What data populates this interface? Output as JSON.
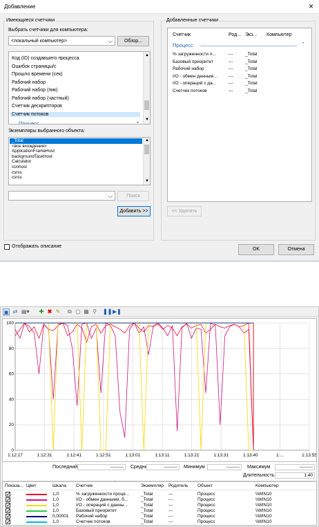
{
  "dialog": {
    "title": "Добавление",
    "close": "×",
    "left_group": "Имеющиеся счетчики",
    "choose_label": "Выбрать счетчики для компьютера:",
    "computer_value": "<локальный компьютер>",
    "browse": "Обзор...",
    "counters": [
      "Код (ID) создавшего процесса",
      "Ошибок страницы/с",
      "Прошло времени (сек)",
      "Рабочий набор",
      "Рабочий набор (пик)",
      "Рабочий набор (частный)",
      "Счетчик дескрипторов",
      "Счетчик потоков"
    ],
    "counter_group": "Процесс",
    "instances_label": "Экземпляры выбранного объекта:",
    "instances": [
      "_Total",
      "<все вхождения>",
      "ApplicationFrameHost",
      "backgroundTaskHost",
      "Calculator",
      "conhost",
      "csrss",
      "csrss"
    ],
    "search": "Поиск",
    "add": "Добавить >>",
    "remove": "<< Удалить",
    "show_desc": "Отображать описание",
    "ok": "OK",
    "cancel": "Отмена",
    "right_group": "Добавленные счетчики",
    "added_cols": [
      "Счетчик",
      "Род...",
      "Экз...",
      "Компьютер"
    ],
    "added_object": "Процесс",
    "added_rows": [
      {
        "counter": "% загруженности п...",
        "parent": "---",
        "inst": "_Total"
      },
      {
        "counter": "Базовый приоритет",
        "parent": "---",
        "inst": "_Total"
      },
      {
        "counter": "Рабочий набор",
        "parent": "---",
        "inst": "_Total"
      },
      {
        "counter": "I/O - обмен данным...",
        "parent": "---",
        "inst": "_Total"
      },
      {
        "counter": "I/O - операций с да...",
        "parent": "---",
        "inst": "_Total"
      },
      {
        "counter": "Счетчик потоков",
        "parent": "---",
        "inst": "_Total"
      }
    ]
  },
  "perfmon": {
    "toolbar_icons": [
      "view-graph-icon",
      "properties-icon",
      "change-graph-icon",
      "add-counter-icon",
      "delete-counter-icon",
      "highlight-icon",
      "copy-icon",
      "paste-icon",
      "properties-sheet-icon",
      "zoom-icon",
      "pause-icon",
      "next-icon"
    ],
    "stats": {
      "last_label": "Последний",
      "last_value": "---------",
      "avg_label": "Средний",
      "avg_value": "---------",
      "min_label": "Минимум",
      "min_value": "---------",
      "max_label": "Максимум",
      "max_value": "---------",
      "dur_label": "Длительность",
      "dur_value": "1:40"
    },
    "table_cols": [
      "Показа...",
      "Цвет",
      "Шкала",
      "Счетчик",
      "Экземпляр",
      "Родитель",
      "Объект",
      "Компьютер"
    ],
    "rows": [
      {
        "color": "#e81123",
        "scale": "1,0",
        "counter": "% загруженности проце...",
        "inst": "_Total",
        "parent": "---",
        "object": "Процесс",
        "computer": "\\\\WIN10"
      },
      {
        "color": "#c71585",
        "scale": "1,0",
        "counter": "I/O - обмен данными, б...",
        "inst": "_Total",
        "parent": "---",
        "object": "Процесс",
        "computer": "\\\\WIN10"
      },
      {
        "color": "#f5d800",
        "scale": "1,0",
        "counter": "I/O - операций с данны...",
        "inst": "_Total",
        "parent": "---",
        "object": "Процесс",
        "computer": "\\\\WIN10"
      },
      {
        "color": "#2ecc40",
        "scale": "1,0",
        "counter": "Базовый приоритет",
        "inst": "_Total",
        "parent": "---",
        "object": "Процесс",
        "computer": "\\\\WIN10"
      },
      {
        "color": "#000080",
        "scale": "0,00001",
        "counter": "Рабочий набор",
        "inst": "_Total",
        "parent": "---",
        "object": "Процесс",
        "computer": "\\\\WIN10"
      },
      {
        "color": "#00b7eb",
        "scale": "1,0",
        "counter": "Счетчик потоков",
        "inst": "_Total",
        "parent": "---",
        "object": "Процесс",
        "computer": "\\\\WIN10"
      }
    ]
  },
  "chart_data": {
    "type": "line",
    "ylim": [
      0,
      100
    ],
    "yticks": [
      0,
      20,
      40,
      60,
      80,
      100
    ],
    "xticks": [
      "1:12:17",
      "1:12:31",
      "1:12:41",
      "1:12:51",
      "1:13:01",
      "1:13:11",
      "1:13:21",
      "1:13:31",
      "1:13:40",
      "1:...",
      "1:13:55"
    ],
    "series": [
      {
        "color": "#c71585",
        "values": [
          95,
          88,
          100,
          97,
          92,
          60,
          99,
          95,
          40,
          99,
          100,
          98,
          80,
          35,
          99,
          100,
          88,
          96,
          45,
          100,
          98,
          90,
          30,
          10,
          95,
          100,
          92,
          97,
          75,
          98,
          100,
          96,
          90,
          98,
          15,
          96,
          100,
          88,
          96,
          95,
          45,
          100,
          98,
          20,
          90,
          97,
          99,
          97,
          92,
          95,
          0
        ]
      },
      {
        "color": "#e81123",
        "values": [
          90,
          95,
          100,
          93,
          97,
          88,
          99,
          95,
          94,
          98,
          100,
          90,
          93,
          99,
          96,
          85,
          97,
          99,
          92,
          98,
          99,
          97,
          95,
          92,
          98,
          100,
          96,
          93,
          98,
          97,
          99,
          95,
          98,
          96,
          90,
          97,
          99,
          96,
          98,
          99,
          92,
          95,
          99,
          97,
          96,
          98,
          99,
          97,
          98,
          100,
          0
        ]
      },
      {
        "color": "#f5d800",
        "values": [
          100,
          100,
          100,
          100,
          100,
          100,
          100,
          100,
          0,
          100,
          100,
          100,
          100,
          100,
          0,
          100,
          100,
          100,
          0,
          0,
          100,
          100,
          100,
          100,
          100,
          100,
          100,
          0,
          100,
          100,
          100,
          100,
          100,
          100,
          100,
          100,
          100,
          100,
          100,
          0,
          100,
          100,
          100,
          100,
          100,
          100,
          100,
          100,
          100,
          0,
          0
        ]
      },
      {
        "color": "#2ecc40",
        "values": [
          100,
          100,
          100,
          100,
          100,
          100,
          100,
          100,
          100,
          100,
          100,
          100,
          100,
          100,
          100,
          100,
          100,
          100,
          100,
          100,
          100,
          100,
          100,
          100,
          100,
          100,
          100,
          100,
          100,
          100,
          100,
          100,
          100,
          100,
          100,
          100,
          100,
          100,
          100,
          100,
          100,
          100,
          100,
          100,
          100,
          100,
          100,
          100,
          100,
          100,
          100
        ]
      },
      {
        "color": "#000080",
        "values": [
          100,
          100,
          100,
          100,
          100,
          100,
          100,
          100,
          100,
          100,
          100,
          100,
          100,
          100,
          100,
          100,
          100,
          100,
          100,
          100,
          100,
          100,
          100,
          100,
          100,
          100,
          100,
          100,
          100,
          100,
          100,
          100,
          100,
          100,
          100,
          100,
          100,
          100,
          100,
          100,
          100,
          100,
          100,
          100,
          100,
          100,
          100,
          100,
          100,
          100,
          100
        ]
      }
    ]
  }
}
